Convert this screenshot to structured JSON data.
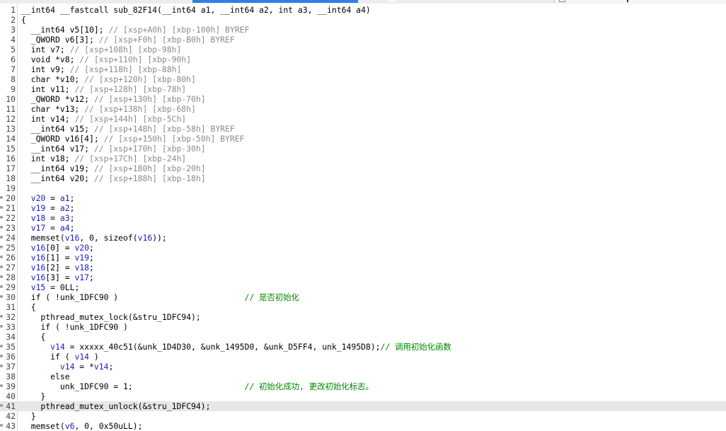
{
  "window": {
    "active_tab_color": "#2f7fe8",
    "comment_color": "#8a8a8a",
    "variable_color": "#1a1acc",
    "keyword_color": "#00007f",
    "highlight_line": 41
  },
  "code_lines": [
    {
      "n": "1",
      "segs": [
        [
          "n",
          "__int64 __fastcall sub_82F14(__int64 a1, __int64 a2, int a3, __int64 a4)"
        ]
      ]
    },
    {
      "n": "2",
      "segs": [
        [
          "n",
          "{"
        ]
      ]
    },
    {
      "n": "3",
      "segs": [
        [
          "n",
          "  __int64 v5[10]; "
        ],
        [
          "c",
          "// [xsp+A0h] [xbp-100h] BYREF"
        ]
      ]
    },
    {
      "n": "4",
      "segs": [
        [
          "n",
          "  _QWORD v6[3]; "
        ],
        [
          "c",
          "// [xsp+F0h] [xbp-B0h] BYREF"
        ]
      ]
    },
    {
      "n": "5",
      "segs": [
        [
          "n",
          "  int v7; "
        ],
        [
          "c",
          "// [xsp+108h] [xbp-98h]"
        ]
      ]
    },
    {
      "n": "6",
      "segs": [
        [
          "n",
          "  void *v8; "
        ],
        [
          "c",
          "// [xsp+110h] [xbp-90h]"
        ]
      ]
    },
    {
      "n": "7",
      "segs": [
        [
          "n",
          "  int v9; "
        ],
        [
          "c",
          "// [xsp+118h] [xbp-88h]"
        ]
      ]
    },
    {
      "n": "8",
      "segs": [
        [
          "n",
          "  char *v10; "
        ],
        [
          "c",
          "// [xsp+120h] [xbp-80h]"
        ]
      ]
    },
    {
      "n": "9",
      "segs": [
        [
          "n",
          "  int v11; "
        ],
        [
          "c",
          "// [xsp+128h] [xbp-78h]"
        ]
      ]
    },
    {
      "n": "10",
      "segs": [
        [
          "n",
          "  _QWORD *v12; "
        ],
        [
          "c",
          "// [xsp+130h] [xbp-70h]"
        ]
      ]
    },
    {
      "n": "11",
      "segs": [
        [
          "n",
          "  char *v13; "
        ],
        [
          "c",
          "// [xsp+138h] [xbp-68h]"
        ]
      ]
    },
    {
      "n": "12",
      "segs": [
        [
          "n",
          "  int v14; "
        ],
        [
          "c",
          "// [xsp+144h] [xbp-5Ch]"
        ]
      ]
    },
    {
      "n": "13",
      "segs": [
        [
          "n",
          "  __int64 v15; "
        ],
        [
          "c",
          "// [xsp+148h] [xbp-58h] BYREF"
        ]
      ]
    },
    {
      "n": "14",
      "segs": [
        [
          "n",
          "  _QWORD v16[4]; "
        ],
        [
          "c",
          "// [xsp+150h] [xbp-50h] BYREF"
        ]
      ]
    },
    {
      "n": "15",
      "segs": [
        [
          "n",
          "  __int64 v17; "
        ],
        [
          "c",
          "// [xsp+170h] [xbp-30h]"
        ]
      ]
    },
    {
      "n": "16",
      "segs": [
        [
          "n",
          "  int v18; "
        ],
        [
          "c",
          "// [xsp+17Ch] [xbp-24h]"
        ]
      ]
    },
    {
      "n": "17",
      "segs": [
        [
          "n",
          "  __int64 v19; "
        ],
        [
          "c",
          "// [xsp+180h] [xbp-20h]"
        ]
      ]
    },
    {
      "n": "18",
      "segs": [
        [
          "n",
          "  __int64 v20; "
        ],
        [
          "c",
          "// [xsp+188h] [xbp-18h]"
        ]
      ]
    },
    {
      "n": "19",
      "segs": []
    },
    {
      "n": "20",
      "dot": true,
      "segs": [
        [
          "n",
          "  "
        ],
        [
          "v",
          "v20"
        ],
        [
          "n",
          " = "
        ],
        [
          "v",
          "a1"
        ],
        [
          "n",
          ";"
        ]
      ]
    },
    {
      "n": "21",
      "dot": true,
      "segs": [
        [
          "n",
          "  "
        ],
        [
          "v",
          "v19"
        ],
        [
          "n",
          " = "
        ],
        [
          "v",
          "a2"
        ],
        [
          "n",
          ";"
        ]
      ]
    },
    {
      "n": "22",
      "dot": true,
      "segs": [
        [
          "n",
          "  "
        ],
        [
          "v",
          "v18"
        ],
        [
          "n",
          " = "
        ],
        [
          "v",
          "a3"
        ],
        [
          "n",
          ";"
        ]
      ]
    },
    {
      "n": "23",
      "dot": true,
      "segs": [
        [
          "n",
          "  "
        ],
        [
          "v",
          "v17"
        ],
        [
          "n",
          " = "
        ],
        [
          "v",
          "a4"
        ],
        [
          "n",
          ";"
        ]
      ]
    },
    {
      "n": "24",
      "dot": true,
      "segs": [
        [
          "n",
          "  memset("
        ],
        [
          "v",
          "v16"
        ],
        [
          "n",
          ", 0, sizeof("
        ],
        [
          "v",
          "v16"
        ],
        [
          "n",
          "));"
        ]
      ]
    },
    {
      "n": "25",
      "dot": true,
      "segs": [
        [
          "n",
          "  "
        ],
        [
          "v",
          "v16"
        ],
        [
          "n",
          "[0] = "
        ],
        [
          "v",
          "v20"
        ],
        [
          "n",
          ";"
        ]
      ]
    },
    {
      "n": "26",
      "dot": true,
      "segs": [
        [
          "n",
          "  "
        ],
        [
          "v",
          "v16"
        ],
        [
          "n",
          "[1] = "
        ],
        [
          "v",
          "v19"
        ],
        [
          "n",
          ";"
        ]
      ]
    },
    {
      "n": "27",
      "dot": true,
      "segs": [
        [
          "n",
          "  "
        ],
        [
          "v",
          "v16"
        ],
        [
          "n",
          "[2] = "
        ],
        [
          "v",
          "v18"
        ],
        [
          "n",
          ";"
        ]
      ]
    },
    {
      "n": "28",
      "dot": true,
      "segs": [
        [
          "n",
          "  "
        ],
        [
          "v",
          "v16"
        ],
        [
          "n",
          "[3] = "
        ],
        [
          "v",
          "v17"
        ],
        [
          "n",
          ";"
        ]
      ]
    },
    {
      "n": "29",
      "dot": true,
      "segs": [
        [
          "n",
          "  "
        ],
        [
          "v",
          "v15"
        ],
        [
          "n",
          " = 0LL;"
        ]
      ]
    },
    {
      "n": "30",
      "dot": true,
      "segs": [
        [
          "n",
          "  if ( !unk_1DFC90 )                          "
        ],
        [
          "g",
          "// 是否初始化"
        ]
      ]
    },
    {
      "n": "31",
      "segs": [
        [
          "n",
          "  {"
        ]
      ]
    },
    {
      "n": "32",
      "dot": true,
      "segs": [
        [
          "n",
          "    pthread_mutex_lock(&stru_1DFC94);"
        ]
      ]
    },
    {
      "n": "33",
      "dot": true,
      "segs": [
        [
          "n",
          "    if ( !unk_1DFC90 )"
        ]
      ]
    },
    {
      "n": "34",
      "segs": [
        [
          "n",
          "    {"
        ]
      ]
    },
    {
      "n": "35",
      "dot": true,
      "segs": [
        [
          "n",
          "      "
        ],
        [
          "v",
          "v14"
        ],
        [
          "n",
          " = xxxxx_40c51(&unk_1D4D30, &unk_1495D0, &unk_D5FF4, unk_1495D8);"
        ],
        [
          "g",
          "// 调用初始化函数"
        ]
      ]
    },
    {
      "n": "36",
      "dot": true,
      "segs": [
        [
          "n",
          "      if ( "
        ],
        [
          "v",
          "v14"
        ],
        [
          "n",
          " )"
        ]
      ]
    },
    {
      "n": "37",
      "dot": true,
      "segs": [
        [
          "n",
          "        "
        ],
        [
          "v",
          "v14"
        ],
        [
          "n",
          " = *"
        ],
        [
          "v",
          "v14"
        ],
        [
          "n",
          ";"
        ]
      ]
    },
    {
      "n": "38",
      "segs": [
        [
          "n",
          "      else"
        ]
      ]
    },
    {
      "n": "39",
      "dot": true,
      "segs": [
        [
          "n",
          "        unk_1DFC90 = 1;                       "
        ],
        [
          "g",
          "// 初始化成功, 更改初始化标志。"
        ]
      ]
    },
    {
      "n": "40",
      "segs": [
        [
          "n",
          "    }"
        ]
      ]
    },
    {
      "n": "41",
      "dot": true,
      "segs": [
        [
          "n",
          "    pthread_mutex_unlock(&stru_1DFC94);"
        ]
      ]
    },
    {
      "n": "42",
      "segs": [
        [
          "n",
          "  }"
        ]
      ]
    },
    {
      "n": "43",
      "dot": true,
      "segs": [
        [
          "n",
          "  memset("
        ],
        [
          "v",
          "v6"
        ],
        [
          "n",
          ", 0, 0x50uLL);"
        ]
      ]
    }
  ]
}
